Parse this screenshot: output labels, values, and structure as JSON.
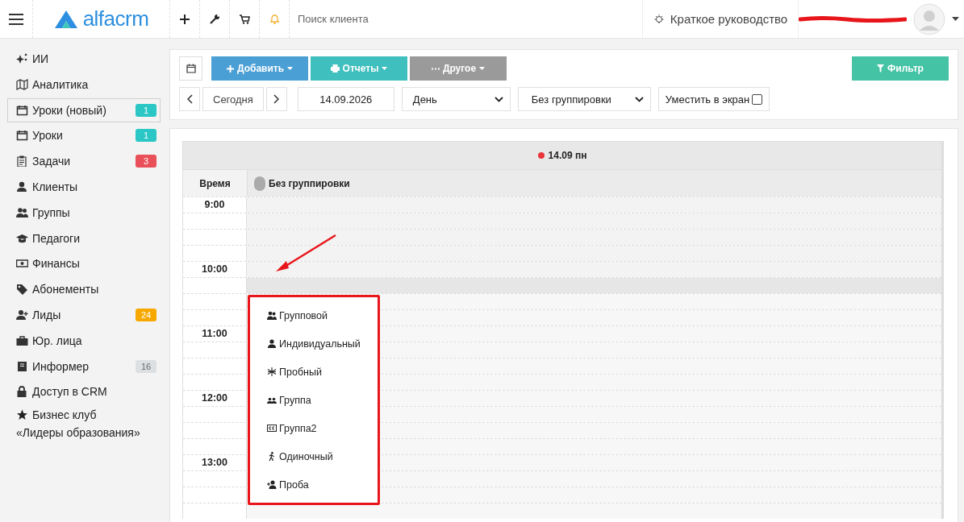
{
  "header": {
    "logo": "alfacrm",
    "search": {
      "placeholder": "Поиск клиента"
    },
    "guide": "Краткое руководство"
  },
  "sidebar": {
    "items": [
      {
        "label": "ИИ",
        "selected": false
      },
      {
        "label": "Аналитика",
        "selected": false
      },
      {
        "label": "Уроки (новый)",
        "badge": "1",
        "color": "#2bc6c6",
        "selected": true
      },
      {
        "label": "Уроки",
        "badge": "1",
        "color": "#2bc6c6",
        "selected": false
      },
      {
        "label": "Задачи",
        "badge": "3",
        "color": "#e9505a",
        "selected": false
      },
      {
        "label": "Клиенты",
        "selected": false
      },
      {
        "label": "Группы",
        "selected": false
      },
      {
        "label": "Педагоги",
        "selected": false
      },
      {
        "label": "Финансы",
        "selected": false
      },
      {
        "label": "Абонементы",
        "selected": false
      },
      {
        "label": "Лиды",
        "badge": "24",
        "color": "#f7a800",
        "selected": false
      },
      {
        "label": "Юр. лица",
        "selected": false
      },
      {
        "label": "Информер",
        "badge": "16",
        "color": "#dde0e3",
        "selected": false
      },
      {
        "label": "Доступ в CRM",
        "selected": false
      },
      {
        "label": "Бизнес клуб «Лидеры образования»",
        "selected": false
      }
    ]
  },
  "toolbar": {
    "buttons": [
      {
        "label": "Добавить",
        "kind": "add",
        "disabled": false
      },
      {
        "label": "Отчеты",
        "kind": "reports",
        "disabled": false
      },
      {
        "label": "Другое",
        "kind": "other",
        "disabled": true
      }
    ],
    "filter": "Фильтр"
  },
  "nav": {
    "today": "Сегодня",
    "date": "14.09.2026",
    "view": "День",
    "grouping": "Без группировки",
    "fit": {
      "label": "Уместить в экран",
      "checked": false
    }
  },
  "calendar": {
    "day": "14.09 пн",
    "time_header": "Время",
    "group_header": "Без группировки",
    "slots": [
      {
        "time": "9:00",
        "kind": "off"
      },
      {
        "kind": "off"
      },
      {
        "kind": "off"
      },
      {
        "kind": "off"
      },
      {
        "time": "10:00",
        "kind": "off"
      },
      {
        "kind": "break"
      },
      {
        "kind": "open"
      },
      {
        "kind": "open"
      },
      {
        "time": "11:00",
        "kind": "open"
      },
      {
        "kind": "open"
      },
      {
        "kind": "open"
      },
      {
        "kind": "open"
      },
      {
        "time": "12:00",
        "kind": "open"
      },
      {
        "kind": "open"
      },
      {
        "kind": "open"
      },
      {
        "kind": "open"
      },
      {
        "time": "13:00",
        "kind": "open"
      },
      {
        "kind": "open"
      },
      {
        "kind": "open"
      },
      {
        "kind": "open"
      }
    ]
  },
  "menu": {
    "items": [
      "Групповой",
      "Индивидуальный",
      "Пробный",
      "Группа",
      "Группа2",
      "Одиночный",
      "Проба"
    ]
  }
}
